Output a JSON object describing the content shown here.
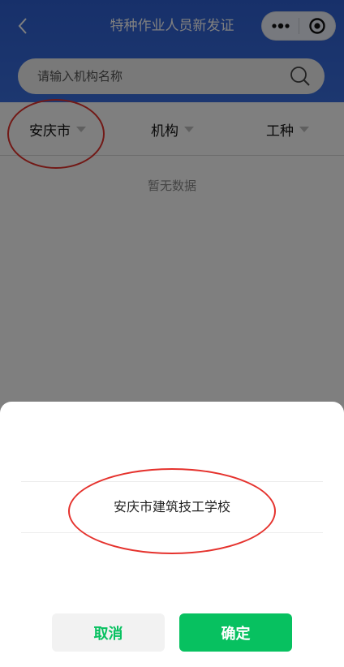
{
  "nav": {
    "title": "特种作业人员新发证",
    "back_icon": "chevron-left-icon",
    "more_icon": "more-dots-icon",
    "close_icon": "target-circle-icon"
  },
  "search": {
    "placeholder": "请输入机构名称",
    "value": "",
    "icon": "search-icon"
  },
  "filters": {
    "city": "安庆市",
    "org": "机构",
    "work_type": "工种"
  },
  "empty_text": "暂无数据",
  "picker": {
    "options": [
      "安庆市建筑技工学校"
    ],
    "cancel_label": "取消",
    "confirm_label": "确定"
  },
  "colors": {
    "header_blue": "#3a6fe0",
    "accent_green": "#07c160",
    "annotation_red": "#e5322d"
  }
}
